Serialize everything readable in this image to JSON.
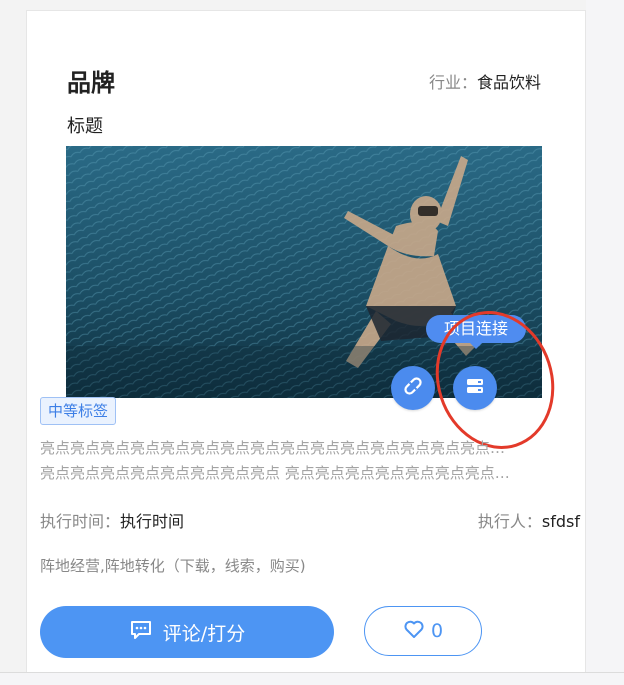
{
  "card": {
    "brand": "品牌",
    "industry_label": "行业：",
    "industry_value": "食品饮料",
    "subtitle": "标题",
    "hero_alt": "diver underwater in seagrass"
  },
  "project_link_tooltip": "项目连接",
  "tag": "中等标签",
  "description_lines": [
    "亮点亮点亮点亮点亮点亮点亮点亮点亮点亮点亮点亮点亮点亮点亮点亮点亮点亮点亮点亮点",
    "亮点亮点亮点亮点亮点亮点亮点亮点 亮点亮点亮点亮点亮点亮点亮点亮点亮点亮点亮点"
  ],
  "exec_time_label": "执行时间：",
  "exec_time_value": "执行时间",
  "executor_label": "执行人：",
  "executor_value": "sfdsf",
  "activity": "阵地经营,阵地转化（下载，线索，购买)",
  "comment_button": "评论/打分",
  "like_count": "0",
  "colors": {
    "accent": "#4d95f3",
    "highlight_ring": "#e33a2a"
  }
}
